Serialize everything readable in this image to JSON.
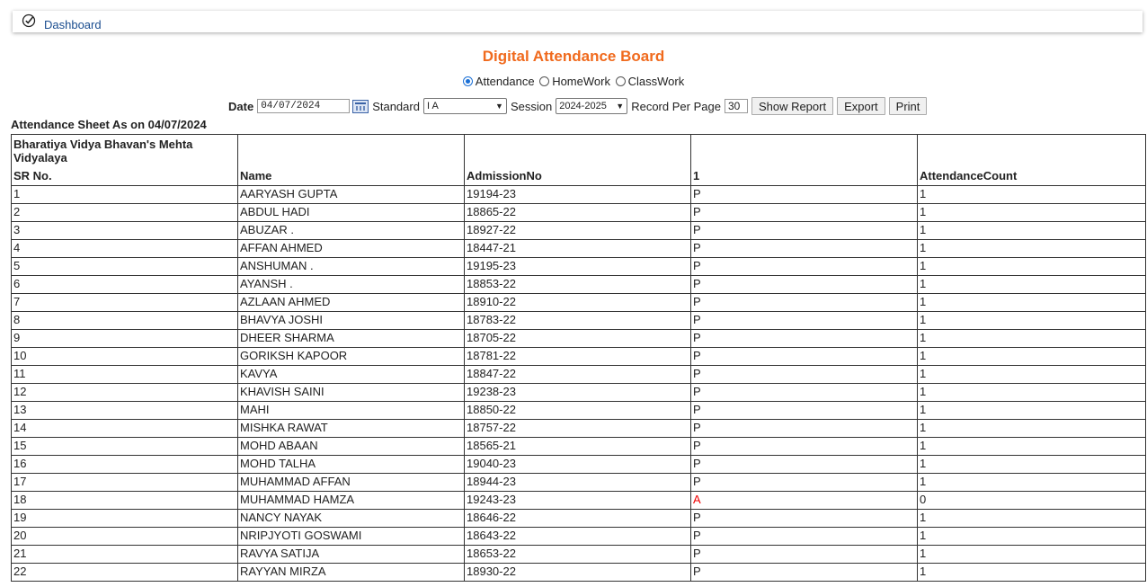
{
  "topbar": {
    "link_label": "Dashboard"
  },
  "title": "Digital Attendance Board",
  "modes": [
    {
      "label": "Attendance",
      "selected": true
    },
    {
      "label": "HomeWork",
      "selected": false
    },
    {
      "label": "ClassWork",
      "selected": false
    }
  ],
  "filters": {
    "date_label": "Date",
    "date_value": "04/07/2024",
    "standard_label": "Standard",
    "standard_value": "I A",
    "session_label": "Session",
    "session_value": "2024-2025",
    "records_label": "Record Per Page",
    "records_value": "30",
    "show_report": "Show Report",
    "export": "Export",
    "print": "Print"
  },
  "sheet_title": "Attendance Sheet As on 04/07/2024",
  "table": {
    "school": "Bharatiya Vidya Bhavan's Mehta Vidyalaya",
    "headers": [
      "SR No.",
      "Name",
      "AdmissionNo",
      "1",
      "AttendanceCount"
    ],
    "rows": [
      [
        "1",
        "AARYASH GUPTA",
        "19194-23",
        "P",
        "1"
      ],
      [
        "2",
        "ABDUL HADI",
        "18865-22",
        "P",
        "1"
      ],
      [
        "3",
        "ABUZAR .",
        "18927-22",
        "P",
        "1"
      ],
      [
        "4",
        "AFFAN AHMED",
        "18447-21",
        "P",
        "1"
      ],
      [
        "5",
        "ANSHUMAN .",
        "19195-23",
        "P",
        "1"
      ],
      [
        "6",
        "AYANSH .",
        "18853-22",
        "P",
        "1"
      ],
      [
        "7",
        "AZLAAN AHMED",
        "18910-22",
        "P",
        "1"
      ],
      [
        "8",
        "BHAVYA JOSHI",
        "18783-22",
        "P",
        "1"
      ],
      [
        "9",
        "DHEER SHARMA",
        "18705-22",
        "P",
        "1"
      ],
      [
        "10",
        "GORIKSH KAPOOR",
        "18781-22",
        "P",
        "1"
      ],
      [
        "11",
        "KAVYA",
        "18847-22",
        "P",
        "1"
      ],
      [
        "12",
        "KHAVISH SAINI",
        "19238-23",
        "P",
        "1"
      ],
      [
        "13",
        "MAHI",
        "18850-22",
        "P",
        "1"
      ],
      [
        "14",
        "MISHKA RAWAT",
        "18757-22",
        "P",
        "1"
      ],
      [
        "15",
        "MOHD ABAAN",
        "18565-21",
        "P",
        "1"
      ],
      [
        "16",
        "MOHD TALHA",
        "19040-23",
        "P",
        "1"
      ],
      [
        "17",
        "MUHAMMAD AFFAN",
        "18944-23",
        "P",
        "1"
      ],
      [
        "18",
        "MUHAMMAD HAMZA",
        "19243-23",
        "A",
        "0"
      ],
      [
        "19",
        "NANCY NAYAK",
        "18646-22",
        "P",
        "1"
      ],
      [
        "20",
        "NRIPJYOTI GOSWAMI",
        "18643-22",
        "P",
        "1"
      ],
      [
        "21",
        "RAVYA SATIJA",
        "18653-22",
        "P",
        "1"
      ],
      [
        "22",
        "RAYYAN MIRZA",
        "18930-22",
        "P",
        "1"
      ]
    ]
  },
  "colors": {
    "title": "#f06a1d",
    "absent": "#e00000",
    "link": "#1a4d8f"
  }
}
